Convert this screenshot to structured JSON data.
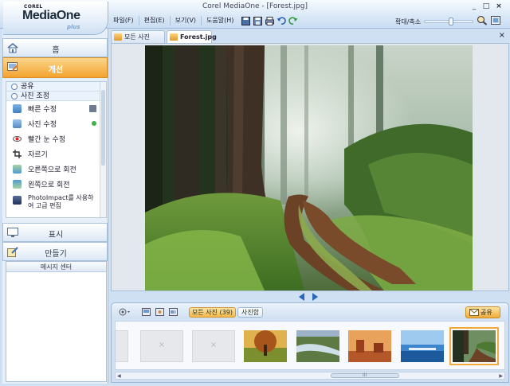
{
  "app": {
    "title": "Corel MediaOne - [Forest.jpg]",
    "logo": {
      "corel": "COREL",
      "brand": "MediaOne",
      "plus": "plus"
    },
    "window_buttons": [
      "_",
      "□",
      "×"
    ]
  },
  "menu": [
    {
      "label": "파일(F)"
    },
    {
      "label": "편집(E)"
    },
    {
      "label": "보기(V)"
    },
    {
      "label": "도움말(H)"
    }
  ],
  "zoom": {
    "label": "확대/축소",
    "level": 0.5
  },
  "sidebar": {
    "home": "홈",
    "fix": "개선",
    "share_section": "공유",
    "adjust_section": "사진 조정",
    "tools": [
      {
        "label": "빠른 수정",
        "icon": "quick-fix-icon"
      },
      {
        "label": "사진 수정",
        "icon": "photo-fix-icon"
      },
      {
        "label": "빨간 눈 수정",
        "icon": "red-eye-icon"
      },
      {
        "label": "자르기",
        "icon": "crop-icon"
      },
      {
        "label": "오른쪽으로 회전",
        "icon": "rotate-right-icon"
      },
      {
        "label": "왼쪽으로 회전",
        "icon": "rotate-left-icon"
      },
      {
        "label": "PhotoImpact를 사용하여 고급 편집",
        "icon": "photoimpact-icon"
      }
    ],
    "view": "표시",
    "create": "만들기",
    "message_center": "메시지 센터"
  },
  "tabs": {
    "all_photos": "모든 사진 (39)",
    "current_file": "Forest.jpg",
    "close": "×"
  },
  "filmstrip": {
    "tab_all": "모든 사진 (39)",
    "tab_album": "사진함",
    "share": "공유",
    "grip": "III",
    "thumbnails": [
      {
        "type": "empty"
      },
      {
        "type": "empty"
      },
      {
        "type": "empty"
      },
      {
        "type": "autumn-tree"
      },
      {
        "type": "river"
      },
      {
        "type": "desert"
      },
      {
        "type": "sea"
      },
      {
        "type": "forest",
        "selected": true
      }
    ]
  },
  "colors": {
    "accent": "#f3a42f",
    "frame": "#cfe0f2",
    "border": "#a8bfd9"
  }
}
